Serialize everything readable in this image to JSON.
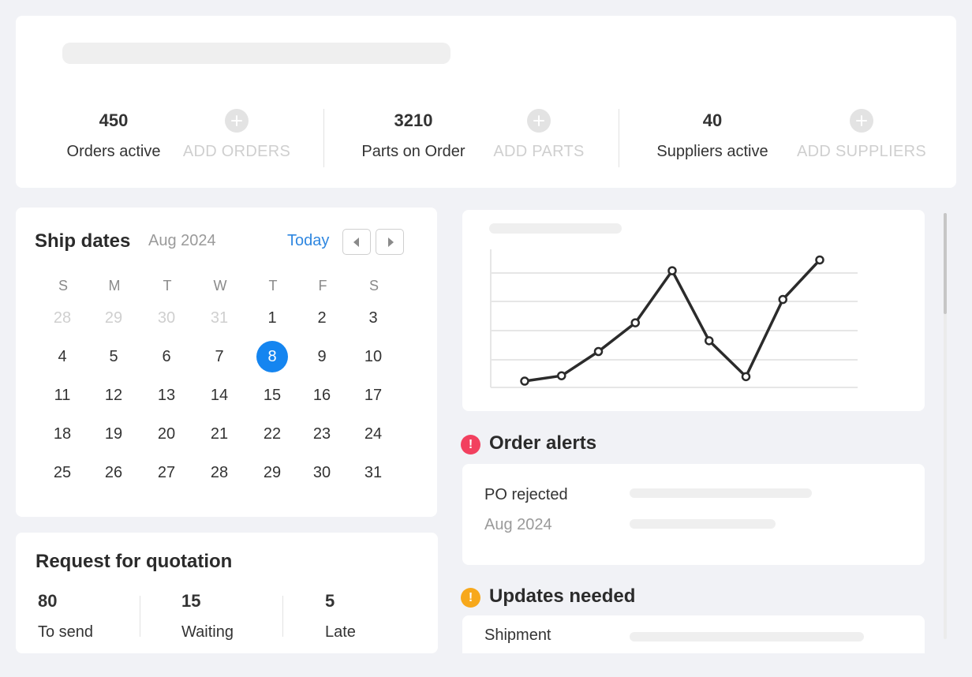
{
  "top_stats": [
    {
      "value": "450",
      "label": "Orders active",
      "add_label": "ADD ORDERS"
    },
    {
      "value": "3210",
      "label": "Parts on Order",
      "add_label": "ADD PARTS"
    },
    {
      "value": "40",
      "label": "Suppliers active",
      "add_label": "ADD SUPPLIERS"
    }
  ],
  "calendar": {
    "title": "Ship dates",
    "month": "Aug 2024",
    "today_label": "Today",
    "weekdays": [
      "S",
      "M",
      "T",
      "W",
      "T",
      "F",
      "S"
    ],
    "weeks": [
      [
        "28",
        "29",
        "30",
        "31",
        "1",
        "2",
        "3"
      ],
      [
        "4",
        "5",
        "6",
        "7",
        "8",
        "9",
        "10"
      ],
      [
        "11",
        "12",
        "13",
        "14",
        "15",
        "16",
        "17"
      ],
      [
        "18",
        "19",
        "20",
        "21",
        "22",
        "23",
        "24"
      ],
      [
        "25",
        "26",
        "27",
        "28",
        "29",
        "30",
        "31"
      ]
    ],
    "selected_day": "8"
  },
  "rfq": {
    "title": "Request for quotation",
    "stats": [
      {
        "value": "80",
        "label": "To send"
      },
      {
        "value": "15",
        "label": "Waiting"
      },
      {
        "value": "5",
        "label": "Late"
      }
    ]
  },
  "chart_data": {
    "type": "line",
    "x": [
      1,
      2,
      3,
      4,
      5,
      6,
      7,
      8,
      9
    ],
    "series": [
      {
        "values": [
          7,
          13,
          40,
          72,
          130,
          52,
          12,
          98,
          142
        ]
      }
    ],
    "ylim": [
      0,
      160
    ],
    "grid": true,
    "colors": {
      "line": "#2b2b2b",
      "marker_fill": "#ffffff",
      "grid": "#e6e6e6"
    }
  },
  "order_alerts": {
    "title": "Order alerts",
    "badge": "!",
    "row_label": "PO rejected",
    "row_sub": "Aug 2024"
  },
  "updates_needed": {
    "title": "Updates needed",
    "badge": "!",
    "row_label": "Shipment"
  },
  "colors": {
    "accent": "#1585f0",
    "link": "#2f87e0",
    "alert_red": "#f2405f",
    "alert_amber": "#f7a81b"
  }
}
